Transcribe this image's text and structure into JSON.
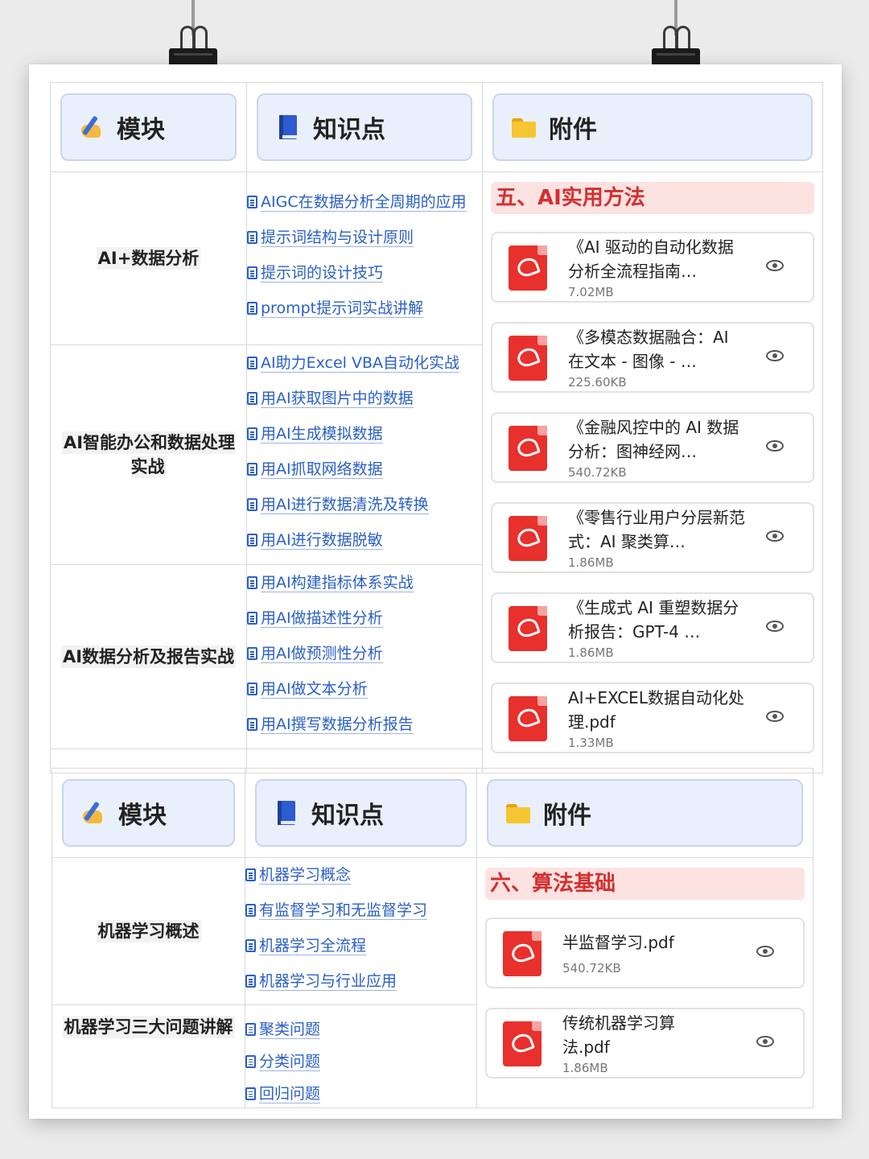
{
  "headers": {
    "module": "模块",
    "knowledge": "知识点",
    "attachment": "附件"
  },
  "icons": {
    "module": "writing-hand-icon",
    "knowledge": "blue-book-icon",
    "attachment": "folder-icon",
    "file": "pdf-icon",
    "preview": "eye-icon",
    "link": "document-icon"
  },
  "table1": {
    "section_title": "五、AI实用方法",
    "rows": [
      {
        "module": "AI+数据分析",
        "links": [
          "AIGC在数据分析全周期的应用",
          "提示词结构与设计原则",
          "提示词的设计技巧",
          "prompt提示词实战讲解"
        ]
      },
      {
        "module": "AI智能办公和数据处理实战",
        "links": [
          "AI助力Excel VBA自动化实战",
          "用AI获取图片中的数据",
          "用AI生成模拟数据",
          "用AI抓取网络数据",
          "用AI进行数据清洗及转换",
          "用AI进行数据脱敏"
        ]
      },
      {
        "module": "AI数据分析及报告实战",
        "links": [
          "用AI构建指标体系实战",
          "用AI做描述性分析",
          "用AI做预测性分析",
          "用AI做文本分析",
          "用AI撰写数据分析报告"
        ]
      }
    ],
    "files": [
      {
        "name": "《AI 驱动的自动化数据分析全流程指南…",
        "size": "7.02MB"
      },
      {
        "name": "《多模态数据融合：AI 在文本 - 图像 - …",
        "size": "225.60KB"
      },
      {
        "name": "《金融风控中的 AI 数据分析：图神经网…",
        "size": "540.72KB"
      },
      {
        "name": "《零售行业用户分层新范式：AI 聚类算…",
        "size": "1.86MB"
      },
      {
        "name": "《生成式 AI 重塑数据分析报告：GPT-4 …",
        "size": "1.86MB"
      },
      {
        "name": "AI+EXCEL数据自动化处理.pdf",
        "size": "1.33MB"
      }
    ]
  },
  "table2": {
    "section_title": "六、算法基础",
    "rows": [
      {
        "module": "机器学习概述",
        "links": [
          "机器学习概念",
          "有监督学习和无监督学习",
          "机器学习全流程",
          "机器学习与行业应用"
        ]
      },
      {
        "module": "机器学习三大问题讲解",
        "links": [
          "聚类问题",
          "分类问题",
          "回归问题"
        ]
      }
    ],
    "files": [
      {
        "name": "半监督学习.pdf",
        "size": "540.72KB"
      },
      {
        "name": "传统机器学习算法.pdf",
        "size": "1.86MB"
      }
    ]
  },
  "colors": {
    "link": "#2a5fc6",
    "section_title": "#d3302e",
    "section_bg": "#fde2e2",
    "header_bg": "#eaf0fb",
    "pdf": "#e8302c"
  }
}
